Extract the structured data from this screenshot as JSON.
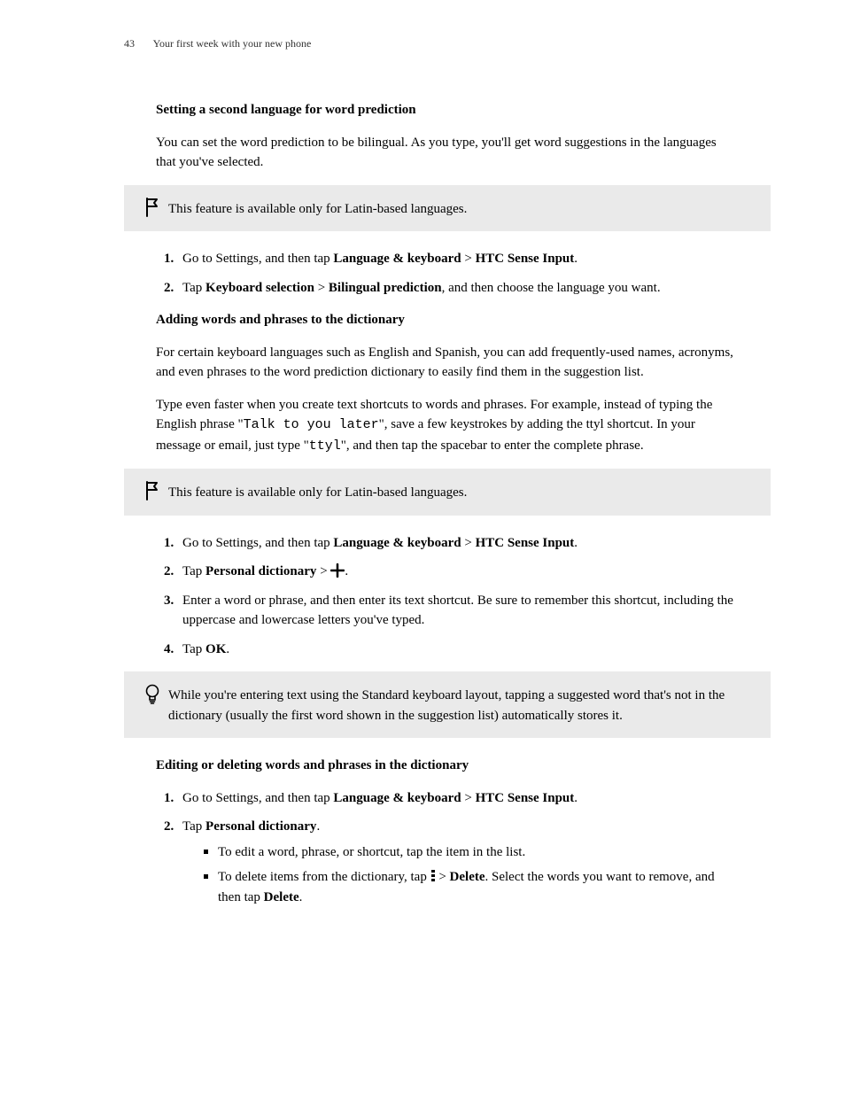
{
  "header": {
    "page_number": "43",
    "title": "Your first week with your new phone"
  },
  "s1": {
    "heading": "Setting a second language for word prediction",
    "intro": "You can set the word prediction to be bilingual. As you type, you'll get word suggestions in the languages that you've selected.",
    "callout": "This feature is available only for Latin-based languages.",
    "step1_pre": "Go to Settings, and then tap ",
    "step1_b1": "Language & keyboard",
    "step1_gt": " > ",
    "step1_b2": "HTC Sense Input",
    "step1_post": ".",
    "step2_pre": "Tap ",
    "step2_b1": "Keyboard selection",
    "step2_gt": " > ",
    "step2_b2": "Bilingual prediction",
    "step2_post": ", and then choose the language you want."
  },
  "s2": {
    "heading": "Adding words and phrases to the dictionary",
    "p1": "For certain keyboard languages such as English and Spanish, you can add frequently-used names, acronyms, and even phrases to the word prediction dictionary to easily find them in the suggestion list.",
    "p2a": "Type even faster when you create text shortcuts to words and phrases. For example, instead of typing the English phrase \"",
    "p2code1": "Talk to you later",
    "p2b": "\", save a few keystrokes by adding the ttyl shortcut. In your message or email, just type \"",
    "p2code2": "ttyl",
    "p2c": "\", and then tap the spacebar to enter the complete phrase.",
    "callout": "This feature is available only for Latin-based languages.",
    "step1_pre": "Go to Settings, and then tap ",
    "step1_b1": "Language & keyboard",
    "step1_gt": " > ",
    "step1_b2": "HTC Sense Input",
    "step1_post": ".",
    "step2_pre": "Tap ",
    "step2_b1": "Personal dictionary",
    "step2_gt": " > ",
    "step2_post": ".",
    "step3": "Enter a word or phrase, and then enter its text shortcut. Be sure to remember this shortcut, including the uppercase and lowercase letters you've typed.",
    "step4_pre": "Tap ",
    "step4_b1": "OK",
    "step4_post": ".",
    "tip": "While you're entering text using the Standard keyboard layout, tapping a suggested word that's not in the dictionary (usually the first word shown in the suggestion list) automatically stores it."
  },
  "s3": {
    "heading": "Editing or deleting words and phrases in the dictionary",
    "step1_pre": "Go to Settings, and then tap ",
    "step1_b1": "Language & keyboard",
    "step1_gt": " > ",
    "step1_b2": "HTC Sense Input",
    "step1_post": ".",
    "step2_pre": "Tap ",
    "step2_b1": "Personal dictionary",
    "step2_post": ".",
    "sub1": "To edit a word, phrase, or shortcut, tap the item in the list.",
    "sub2_pre": "To delete items from the dictionary, tap ",
    "sub2_gt": " > ",
    "sub2_b1": "Delete",
    "sub2_mid": ". Select the words you want to remove, and then tap ",
    "sub2_b2": "Delete",
    "sub2_post": "."
  }
}
